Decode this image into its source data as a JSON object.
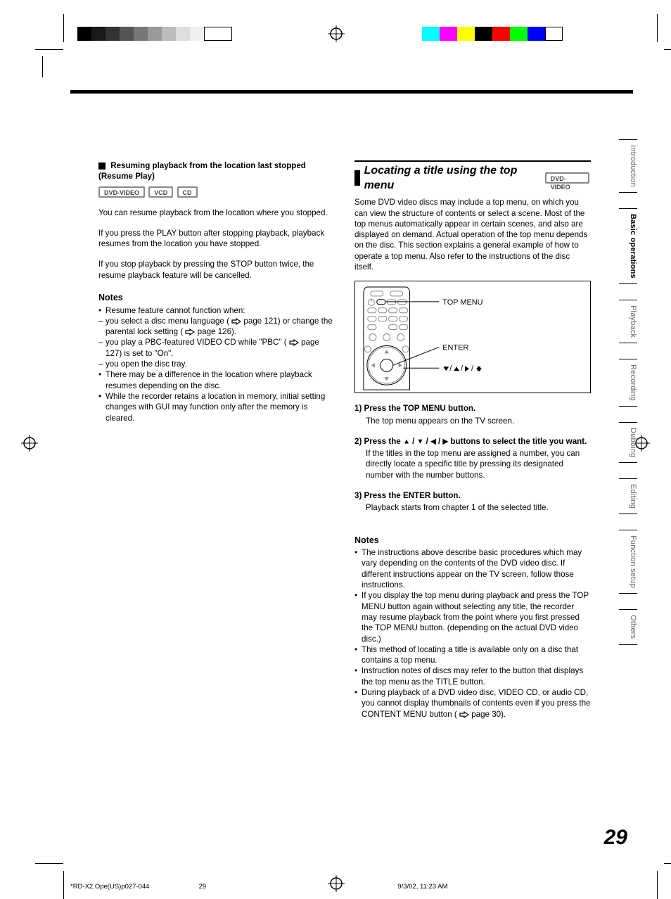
{
  "left": {
    "section_title": "Resuming playback from the location last stopped (Resume Play)",
    "tags": [
      "DVD-VIDEO",
      "VCD",
      "CD"
    ],
    "p1": "You can resume playback from the location where you stopped.",
    "p2": "If you press the PLAY button after stopping playback, playback resumes from the location you have stopped.",
    "p3": "If you stop playback by pressing the STOP button twice, the resume playback feature will be cancelled.",
    "notes_h": "Notes",
    "n1": "Resume feature cannot function when:",
    "n2a": "you select a disc menu language (",
    "n2b": " page 121) or change the parental lock setting (",
    "n2c": " page 126).",
    "n3a": "you play a PBC-featured VIDEO CD while \"PBC\" (",
    "n3b": " page 127) is set to \"On\".",
    "n4": "you open the disc tray.",
    "n5": "There may be a difference in the location where playback resumes depending on the disc.",
    "n6": "While the recorder retains a location in memory, initial setting changes with GUI may function only after the memory is cleared."
  },
  "right": {
    "title": "Locating a title using the top menu",
    "title_tag": "DVD-VIDEO",
    "intro": "Some DVD video discs may include a top menu, on which you can view the structure of contents or select a scene. Most of the top menus automatically appear in certain scenes, and also are displayed on demand. Actual operation of the top menu depends on the disc. This section explains a general example of how to operate a top menu. Also refer to the instructions of the disc itself.",
    "labels": {
      "topmenu": "TOP MENU",
      "enter": "ENTER"
    },
    "step1_lead": "1) Press the TOP MENU button.",
    "step1_body": "The top menu appears on the TV screen.",
    "step2_lead_a": "2) Press the ",
    "step2_lead_b": " buttons to select the title you want.",
    "step2_body": "If the titles in the top menu are assigned a number, you can directly locate a specific title by pressing its designated number with the number buttons.",
    "step3_lead": "3) Press the ENTER button.",
    "step3_body": "Playback starts from chapter 1 of the selected title.",
    "notes_h": "Notes",
    "rn1": "The instructions above describe basic procedures which may vary depending on the contents of the DVD video disc. If different instructions appear on the TV screen, follow those instructions.",
    "rn2": "If you display the top menu during playback and press the TOP MENU button again without selecting any title, the recorder may resume playback from the point where you first pressed the TOP MENU button. (depending on the actual DVD video disc.)",
    "rn3": "This method of locating a title is available only on a disc that contains a top menu.",
    "rn4": "Instruction notes of discs may refer to the button that displays the top menu as the TITLE button.",
    "rn5a": "During playback of a DVD video disc, VIDEO CD, or audio CD, you cannot display thumbnails of contents even if you press the CONTENT MENU button (",
    "rn5b": " page 30)."
  },
  "tabs": [
    "Introduction",
    "Basic operations",
    "Playback",
    "Recording",
    "Dubbing",
    "Editing",
    "Function setup",
    "Others"
  ],
  "page_number": "29",
  "footer": {
    "file": "*RD-X2.Ope(US)p027-044",
    "pg": "29",
    "dt": "9/3/02, 11:23 AM"
  }
}
